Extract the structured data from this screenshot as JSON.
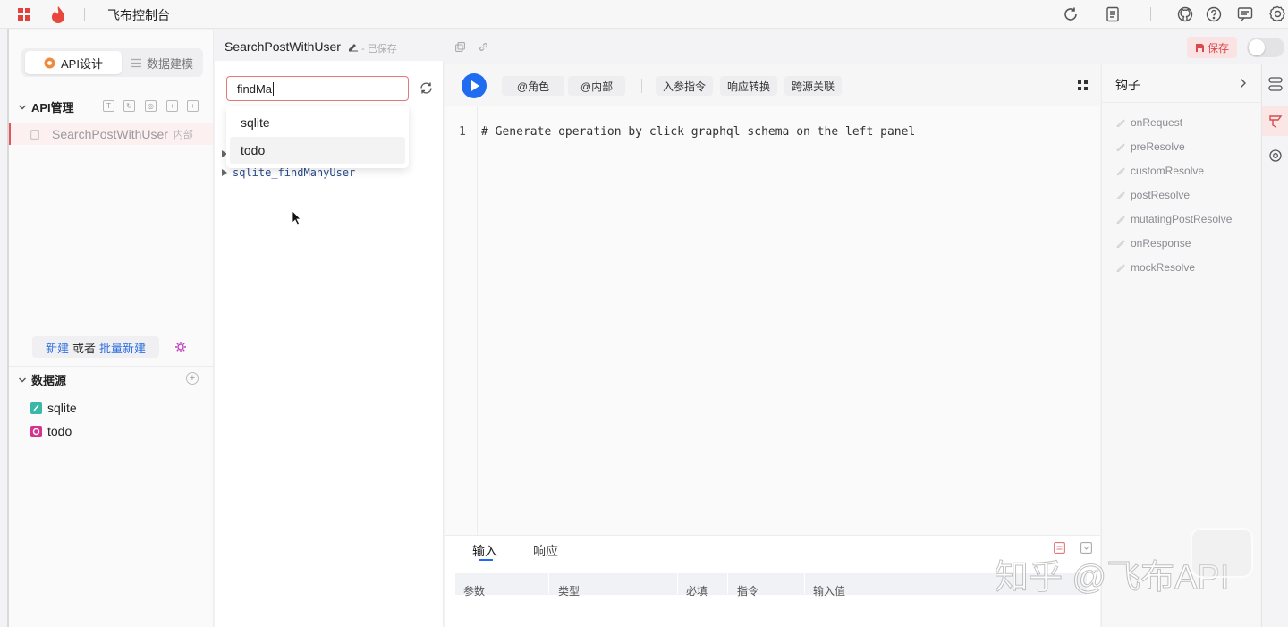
{
  "app": {
    "title": "飞布控制台"
  },
  "left": {
    "tabs": [
      "API设计",
      "数据建模"
    ],
    "api_section": "API管理",
    "api_items": [
      {
        "name": "SearchPostWithUser",
        "tag": "内部"
      }
    ],
    "new_label": "新建",
    "or_label": "或者",
    "batch_label": "批量新建",
    "datasource_section": "数据源",
    "datasources": [
      "sqlite",
      "todo"
    ]
  },
  "header": {
    "api_name": "SearchPostWithUser",
    "saved": "- 已保存",
    "save_label": "保存"
  },
  "explorer": {
    "search_value": "findMa",
    "suggestions": [
      "sqlite",
      "todo"
    ],
    "tree_item": "sqlite_findManyUser"
  },
  "toolbar": {
    "role": "@角色",
    "internal": "@内部",
    "param_directive": "入参指令",
    "response_transform": "响应转换",
    "cross_source": "跨源关联"
  },
  "editor": {
    "line_number": "1",
    "line_text": "# Generate operation by click graphql schema on the left panel"
  },
  "bottom": {
    "tabs": [
      "输入",
      "响应"
    ],
    "columns": [
      "参数",
      "类型",
      "必填",
      "指令",
      "输入值"
    ]
  },
  "hooks": {
    "title": "钩子",
    "items": [
      "onRequest",
      "preResolve",
      "customResolve",
      "postResolve",
      "mutatingPostResolve",
      "onResponse",
      "mockResolve"
    ]
  },
  "watermark": "知乎 @飞布API",
  "colors": {
    "accent": "#1f6cf0",
    "link": "#2f6fe0",
    "danger": "#e0565b",
    "brand": "#e8473e"
  }
}
